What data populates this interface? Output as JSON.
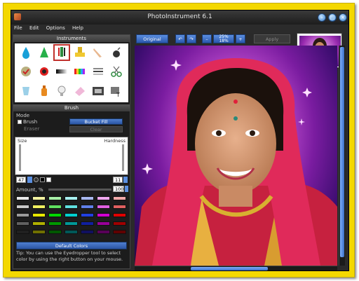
{
  "window": {
    "title": "PhotoInstrument 6.1"
  },
  "menu": [
    "File",
    "Edit",
    "Options",
    "Help"
  ],
  "panels": {
    "instruments_title": "Instruments",
    "brush_title": "Brush"
  },
  "brush": {
    "mode_label": "Mode",
    "brush_label": "Brush",
    "eraser_label": "Eraser",
    "bucket_fill_label": "Bucket Fill",
    "clear_label": "Clear",
    "size_label": "Size",
    "hardness_label": "Hardness",
    "size_value": "47",
    "hardness_value": "11",
    "amount_label": "Amount, %",
    "amount_value": "100",
    "default_colors_label": "Default Colors",
    "tip_text": "Tip: You can use the Eyedropper tool to select color by using the right button on your mouse."
  },
  "toolbar": {
    "original_label": "Original",
    "zoom_top": "25%",
    "zoom_bottom": "18%",
    "apply_label": "Apply"
  },
  "colors": {
    "accent": "#2f62b8",
    "frame": "#f4d800",
    "palette": [
      [
        "#e8e8e8",
        "#f2f2a0",
        "#a8f0a8",
        "#a8f0f0",
        "#a8b8f0",
        "#f0a8f0",
        "#f0a8a8"
      ],
      [
        "#c8c8c8",
        "#f0f060",
        "#60e060",
        "#60e0e0",
        "#6080e8",
        "#e060e0",
        "#e06060"
      ],
      [
        "#9a9a9a",
        "#e8e800",
        "#00d800",
        "#00d0d0",
        "#2040e0",
        "#d000d0",
        "#e00000"
      ],
      [
        "#606060",
        "#b0b000",
        "#009800",
        "#009898",
        "#1020a0",
        "#980098",
        "#a00000"
      ],
      [
        "#202020",
        "#707000",
        "#005800",
        "#005858",
        "#101060",
        "#580058",
        "#600000"
      ]
    ]
  }
}
